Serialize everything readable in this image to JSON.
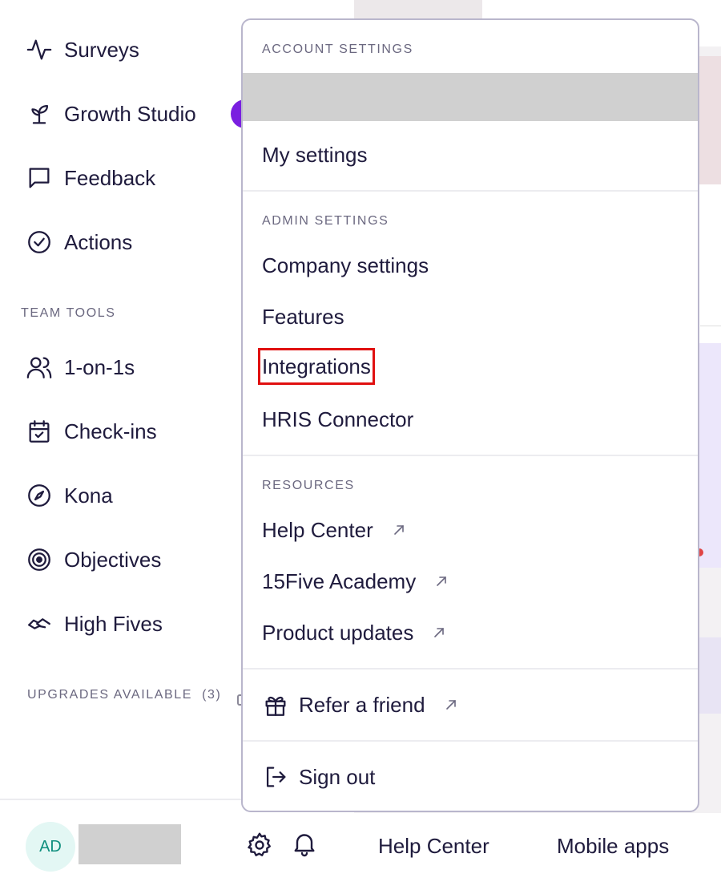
{
  "sidebar": {
    "nav_top": [
      {
        "label": "Surveys",
        "icon": "activity-icon"
      },
      {
        "label": "Growth Studio",
        "icon": "sprout-icon"
      },
      {
        "label": "Feedback",
        "icon": "message-square-icon"
      },
      {
        "label": "Actions",
        "icon": "check-circle-icon"
      }
    ],
    "team_tools_label": "TEAM TOOLS",
    "nav_team": [
      {
        "label": "1-on-1s",
        "icon": "users-icon"
      },
      {
        "label": "Check-ins",
        "icon": "calendar-check-icon"
      },
      {
        "label": "Kona",
        "icon": "compass-icon"
      },
      {
        "label": "Objectives",
        "icon": "target-icon"
      },
      {
        "label": "High Fives",
        "icon": "handshake-icon"
      }
    ],
    "upgrades_label": "UPGRADES AVAILABLE",
    "upgrades_count": "(3)",
    "user_initials": "AD",
    "accent_purple": "#7a1fe0"
  },
  "menu": {
    "account_label": "ACCOUNT SETTINGS",
    "my_settings": "My settings",
    "admin_label": "ADMIN SETTINGS",
    "company_settings": "Company settings",
    "features": "Features",
    "integrations": "Integrations",
    "hris": "HRIS Connector",
    "resources_label": "RESOURCES",
    "help_center": "Help Center",
    "academy": "15Five Academy",
    "product_updates": "Product updates",
    "refer": "Refer a friend",
    "sign_out": "Sign out",
    "highlight_color": "#e01010"
  },
  "footer": {
    "help_center": "Help Center",
    "mobile_apps": "Mobile apps"
  }
}
